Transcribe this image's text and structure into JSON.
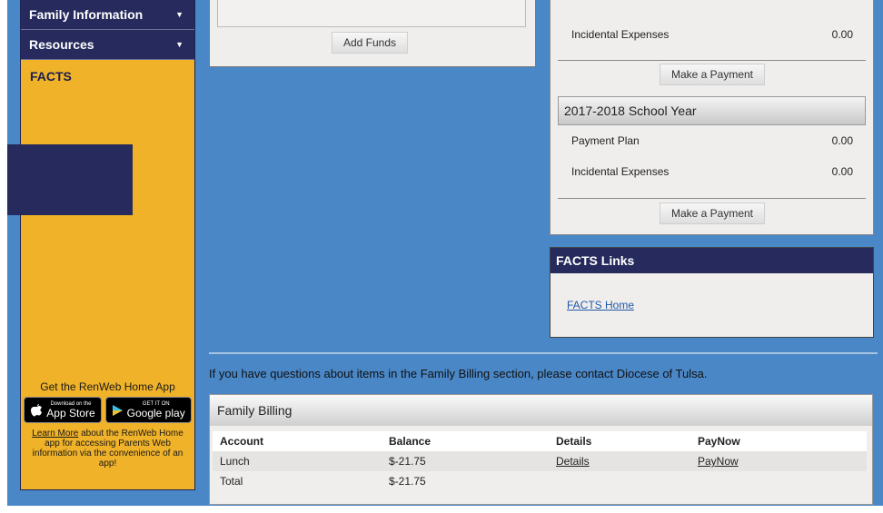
{
  "sidebar": {
    "items": [
      {
        "label": "Family Information"
      },
      {
        "label": "Resources"
      }
    ],
    "section_label": "FACTS"
  },
  "app_promo": {
    "title": "Get the RenWeb Home App",
    "app_store": {
      "small": "Download on the",
      "big": "App Store"
    },
    "google_play": {
      "small": "GET IT ON",
      "big": "Google play"
    },
    "learn_more": "Learn More",
    "text": " about the RenWeb Home app for accessing Parents Web information via the convenience of an app!"
  },
  "funds": {
    "add_funds_label": "Add Funds"
  },
  "payments": {
    "prev_incidental": {
      "label": "Incidental Expenses",
      "value": "0.00"
    },
    "make_payment_label": "Make a Payment",
    "year_title": "2017-2018 School Year",
    "payment_plan": {
      "label": "Payment Plan",
      "value": "0.00"
    },
    "incidental": {
      "label": "Incidental Expenses",
      "value": "0.00"
    }
  },
  "facts_links": {
    "title": "FACTS Links",
    "home_link": "FACTS Home"
  },
  "notice": "If you have questions about items in the Family Billing section, please contact Diocese of Tulsa.",
  "billing": {
    "title": "Family Billing",
    "columns": [
      "Account",
      "Balance",
      "Details",
      "PayNow"
    ],
    "rows": [
      {
        "account": "Lunch",
        "balance": "$-21.75",
        "details": "Details",
        "paynow": "PayNow"
      },
      {
        "account": "Total",
        "balance": "$-21.75"
      }
    ]
  }
}
